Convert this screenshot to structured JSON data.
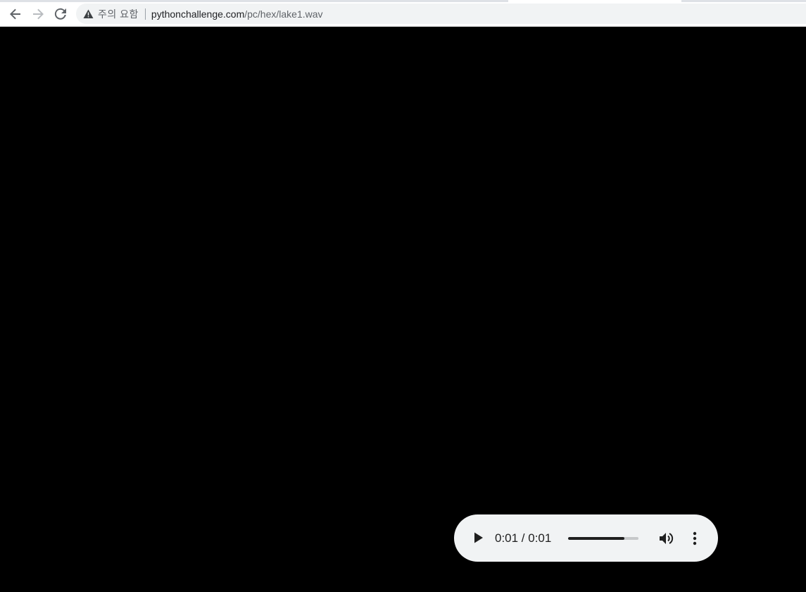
{
  "browser": {
    "security_label": "주의 요함",
    "url_host": "pythonchallenge.com",
    "url_path": "/pc/hex/lake1.wav",
    "icons": {
      "back": "arrow-left-icon",
      "forward": "arrow-right-icon",
      "reload": "reload-icon",
      "security": "warning-triangle-icon"
    }
  },
  "audio_player": {
    "time_display": "0:01 / 0:01",
    "progress_fraction": 0.8,
    "icons": {
      "play": "play-icon",
      "volume": "volume-icon",
      "menu": "more-vertical-icon"
    },
    "colors": {
      "background": "#f1f3f4",
      "progress_fill": "#1f1f1f",
      "progress_track": "#c6c8ca"
    }
  },
  "page": {
    "background_color": "#000000"
  }
}
